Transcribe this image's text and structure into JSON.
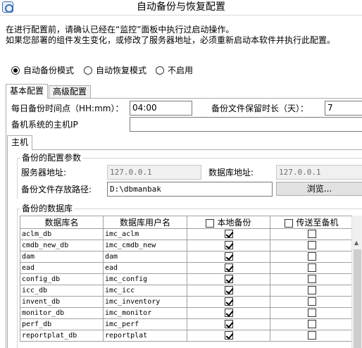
{
  "window": {
    "title": "自动备份与恢复配置"
  },
  "notice": {
    "line1": "在进行配置前，请确认已经在“监控”面板中执行过启动操作。",
    "line2": "如果您部署的组件发生变化，或修改了服务器地址，必须重新启动本软件并执行此配置。"
  },
  "mode": {
    "options": [
      {
        "label": "自动备份模式",
        "checked": true
      },
      {
        "label": "自动恢复模式",
        "checked": false
      },
      {
        "label": "不启用",
        "checked": false
      }
    ]
  },
  "tabs": [
    {
      "label": "基本配置",
      "active": true
    },
    {
      "label": "高级配置",
      "active": false
    }
  ],
  "basic": {
    "backup_time_label": "每日备份时间点（HH:mm）：",
    "backup_time_value": "04:00",
    "retention_label": "备份文件保留时长（天）：",
    "retention_value": "7",
    "standby_ip_label": "备机系统的主机IP",
    "standby_ip_value": ""
  },
  "subtab": {
    "label": "主机"
  },
  "backup_params": {
    "title": "备份的配置参数",
    "server_label": "服务器地址:",
    "server_value": "127.0.0.1",
    "db_label": "数据库地址:",
    "db_value": "127.0.0.1",
    "path_label": "备份文件存放路径:",
    "path_value": "D:\\dbmanbak",
    "browse_label": "浏览..."
  },
  "databases": {
    "title": "备份的数据库",
    "columns": [
      "数据库名",
      "数据库用户名",
      "本地备份",
      "传送至备机"
    ],
    "rows": [
      {
        "name": "aclm_db",
        "user": "imc_aclm",
        "local": true,
        "remote": false
      },
      {
        "name": "cmdb_new_db",
        "user": "imc_cmdb_new",
        "local": true,
        "remote": false
      },
      {
        "name": "dam",
        "user": "dam",
        "local": true,
        "remote": false
      },
      {
        "name": "ead",
        "user": "ead",
        "local": true,
        "remote": false
      },
      {
        "name": "config_db",
        "user": "imc_config",
        "local": true,
        "remote": false
      },
      {
        "name": "icc_db",
        "user": "imc_icc",
        "local": true,
        "remote": false
      },
      {
        "name": "invent_db",
        "user": "imc_inventory",
        "local": true,
        "remote": false
      },
      {
        "name": "monitor_db",
        "user": "imc_monitor",
        "local": true,
        "remote": false
      },
      {
        "name": "perf_db",
        "user": "imc_perf",
        "local": true,
        "remote": false
      },
      {
        "name": "reportplat_db",
        "user": "reportplat",
        "local": true,
        "remote": false
      }
    ]
  }
}
